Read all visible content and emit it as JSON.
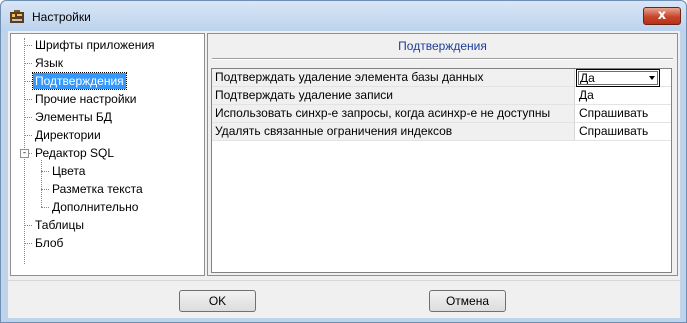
{
  "window": {
    "title": "Настройки",
    "close_label": "x"
  },
  "tree": {
    "items": [
      {
        "label": "Шрифты приложения"
      },
      {
        "label": "Язык"
      },
      {
        "label": "Подтверждения",
        "selected": true
      },
      {
        "label": "Прочие настройки"
      },
      {
        "label": "Элементы БД"
      },
      {
        "label": "Директории"
      },
      {
        "label": "Редактор SQL",
        "expanded": true,
        "expander": "-"
      },
      {
        "label": "Цвета"
      },
      {
        "label": "Разметка текста"
      },
      {
        "label": "Дополнительно"
      },
      {
        "label": "Таблицы"
      },
      {
        "label": "Блоб"
      }
    ]
  },
  "panel": {
    "title": "Подтверждения",
    "rows": [
      {
        "name": "Подтверждать удаление элемента базы данных",
        "value": "Да",
        "editor": "dropdown"
      },
      {
        "name": "Подтверждать удаление записи",
        "value": "Да"
      },
      {
        "name": "Использовать синхр-е запросы, когда асинхр-е не доступны",
        "value": "Спрашивать"
      },
      {
        "name": "Удалять связанные ограничения индексов",
        "value": "Спрашивать"
      }
    ]
  },
  "buttons": {
    "ok": "OK",
    "cancel": "Отмена"
  }
}
